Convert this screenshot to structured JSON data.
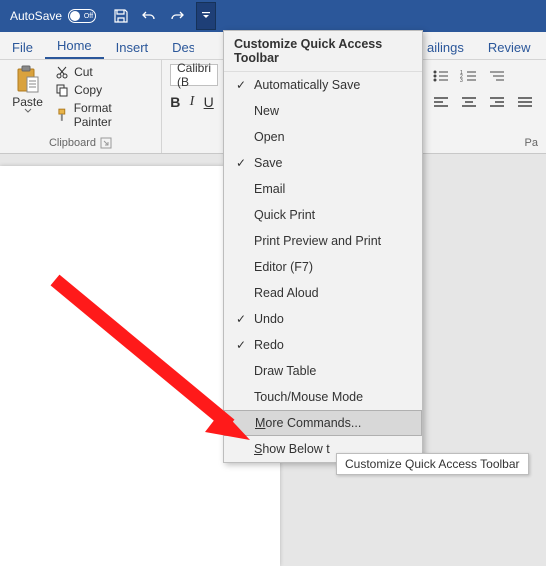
{
  "titlebar": {
    "autosave_label": "AutoSave",
    "autosave_state": "Off"
  },
  "tabs": {
    "file": "File",
    "home": "Home",
    "insert": "Insert",
    "design_cut": "Desi",
    "mailings_cut": "ailings",
    "review": "Review"
  },
  "clipboard": {
    "paste": "Paste",
    "cut": "Cut",
    "copy": "Copy",
    "format_painter": "Format Painter",
    "group_label": "Clipboard"
  },
  "font": {
    "name_cut": "Calibri (B",
    "bold": "B",
    "italic": "I",
    "underline": "U"
  },
  "paragraph": {
    "group_label_cut": "Pa"
  },
  "dropdown": {
    "title": "Customize Quick Access Toolbar",
    "items": [
      {
        "label": "Automatically Save",
        "checked": true
      },
      {
        "label": "New",
        "checked": false
      },
      {
        "label": "Open",
        "checked": false
      },
      {
        "label": "Save",
        "checked": true
      },
      {
        "label": "Email",
        "checked": false
      },
      {
        "label": "Quick Print",
        "checked": false
      },
      {
        "label": "Print Preview and Print",
        "checked": false
      },
      {
        "label": "Editor (F7)",
        "checked": false
      },
      {
        "label": "Read Aloud",
        "checked": false
      },
      {
        "label": "Undo",
        "checked": true
      },
      {
        "label": "Redo",
        "checked": true
      },
      {
        "label": "Draw Table",
        "checked": false
      },
      {
        "label": "Touch/Mouse Mode",
        "checked": false
      }
    ],
    "more_commands": "More Commands...",
    "show_below_cut": "Show Below t"
  },
  "tooltip": "Customize Quick Access Toolbar"
}
